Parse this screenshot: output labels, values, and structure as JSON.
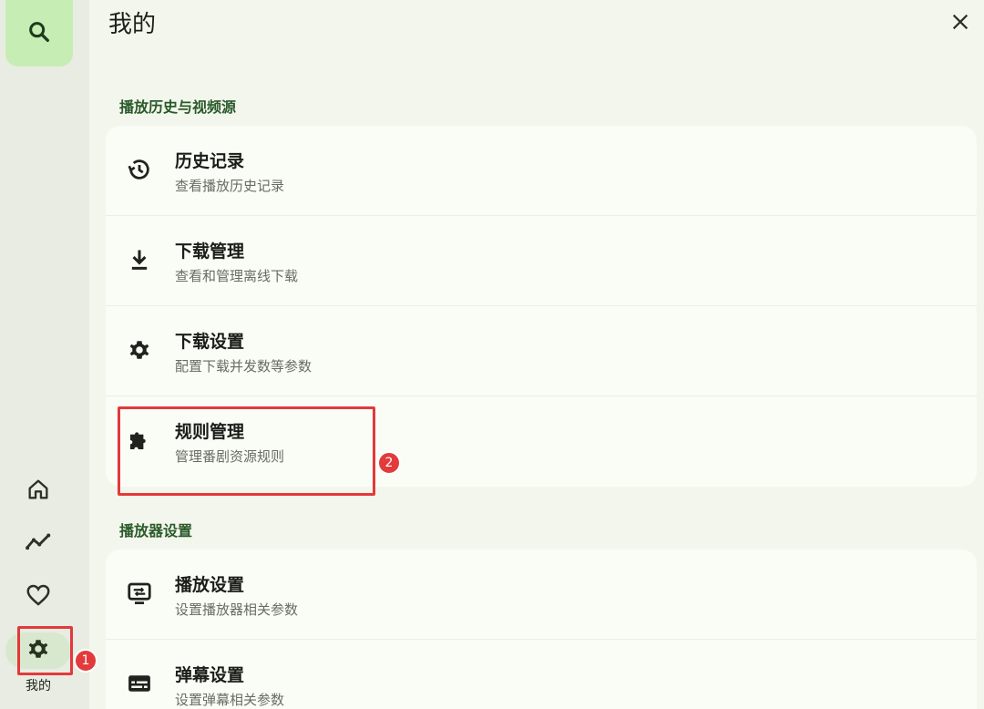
{
  "page": {
    "title": "我的",
    "close_icon": "close-icon"
  },
  "rail": {
    "fab_icon": "search-icon",
    "items": [
      {
        "icon": "home-icon"
      },
      {
        "icon": "trending-icon"
      },
      {
        "icon": "heart-icon"
      },
      {
        "icon": "gear-icon",
        "label": "我的",
        "active": true
      }
    ]
  },
  "sections": [
    {
      "header": "播放历史与视频源",
      "items": [
        {
          "icon": "history-icon",
          "title": "历史记录",
          "subtitle": "查看播放历史记录"
        },
        {
          "icon": "download-icon",
          "title": "下载管理",
          "subtitle": "查看和管理离线下载"
        },
        {
          "icon": "gear-icon",
          "title": "下载设置",
          "subtitle": "配置下载并发数等参数"
        },
        {
          "icon": "puzzle-icon",
          "title": "规则管理",
          "subtitle": "管理番剧资源规则"
        }
      ]
    },
    {
      "header": "播放器设置",
      "items": [
        {
          "icon": "player-settings-icon",
          "title": "播放设置",
          "subtitle": "设置播放器相关参数"
        },
        {
          "icon": "subtitles-icon",
          "title": "弹幕设置",
          "subtitle": "设置弹幕相关参数"
        }
      ]
    }
  ],
  "annotations": [
    {
      "label": "1"
    },
    {
      "label": "2"
    }
  ],
  "colors": {
    "accent_fab": "#c6edb4",
    "section_header": "#2a5a2a",
    "annotation_red": "#e3393a"
  }
}
